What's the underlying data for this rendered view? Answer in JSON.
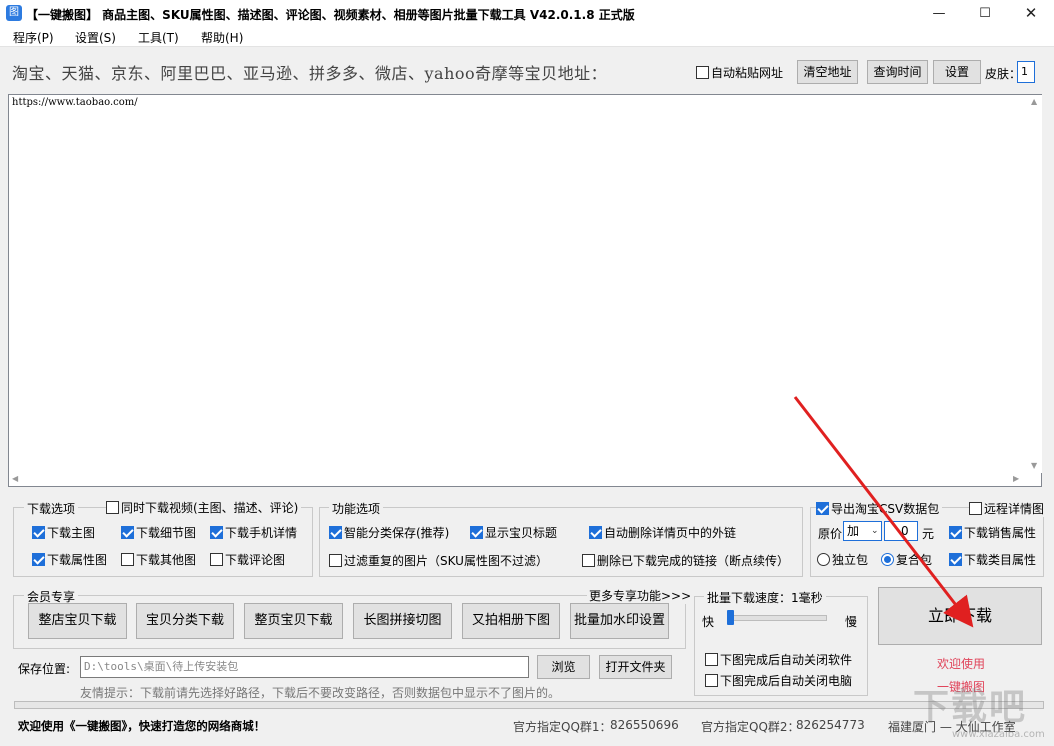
{
  "window": {
    "title": "【一键搬图】 商品主图、SKU属性图、描述图、评论图、视频素材、相册等图片批量下载工具 V42.0.1.8 正式版",
    "min_glyph": "—",
    "max_glyph": "☐",
    "close_glyph": "✕"
  },
  "menu": {
    "items": [
      "程序(P)",
      "设置(S)",
      "工具(T)",
      "帮助(H)"
    ]
  },
  "address": {
    "label": "淘宝、天猫、京东、阿里巴巴、亚马逊、拼多多、微店、yahoo奇摩等宝贝地址：",
    "auto_paste": "自动粘贴网址",
    "auto_paste_checked": false,
    "clear_button": "清空地址",
    "query_time_button": "查询时间",
    "settings_button": "设置",
    "skin_label": "皮肤：",
    "skin_value": "1",
    "url_text": "https://www.taobao.com/"
  },
  "download_options": {
    "title": "下载选项",
    "video_option": {
      "label": "同时下载视频(主图、描述、评论)",
      "checked": false
    },
    "items": [
      {
        "label": "下载主图",
        "checked": true
      },
      {
        "label": "下载细节图",
        "checked": true
      },
      {
        "label": "下载手机详情",
        "checked": true
      },
      {
        "label": "下载属性图",
        "checked": true
      },
      {
        "label": "下载其他图",
        "checked": false
      },
      {
        "label": "下载评论图",
        "checked": false
      }
    ]
  },
  "function_options": {
    "title": "功能选项",
    "items": [
      {
        "label": "智能分类保存(推荐)",
        "checked": true
      },
      {
        "label": "显示宝贝标题",
        "checked": true
      },
      {
        "label": "自动删除详情页中的外链",
        "checked": true
      },
      {
        "label": "过滤重复的图片（SKU属性图不过滤）",
        "checked": false
      },
      {
        "label": "删除已下载完成的链接（断点续传）",
        "checked": false
      }
    ]
  },
  "csv_options": {
    "export_csv": {
      "label": "导出淘宝CSV数据包",
      "checked": true
    },
    "remote_detail": {
      "label": "远程详情图",
      "checked": false
    },
    "price_label": "原价",
    "price_op": "加",
    "price_value": "0",
    "currency": "元",
    "sales_attr": {
      "label": "下载销售属性",
      "checked": true
    },
    "category_attr": {
      "label": "下载类目属性",
      "checked": true
    },
    "pack_independent": {
      "label": "独立包",
      "checked": false
    },
    "pack_composite": {
      "label": "复合包",
      "checked": true
    }
  },
  "member": {
    "title": "会员专享",
    "more_link": "更多专享功能>>>",
    "buttons": [
      "整店宝贝下载",
      "宝贝分类下载",
      "整页宝贝下载",
      "长图拼接切图",
      "又拍相册下图",
      "批量加水印设置"
    ]
  },
  "speed": {
    "title": "批量下载速度：1毫秒",
    "fast": "快",
    "slow": "慢",
    "auto_close_app": {
      "label": "下图完成后自动关闭软件",
      "checked": false
    },
    "auto_shutdown": {
      "label": "下图完成后自动关闭电脑",
      "checked": false
    }
  },
  "download_button": "立即下载",
  "save": {
    "label": "保存位置:",
    "path": "D:\\tools\\桌面\\待上传安装包",
    "browse_button": "浏览",
    "open_folder_button": "打开文件夹",
    "tip": "友情提示：下载前请先选择好路径，下载后不要改变路径，否则数据包中显示不了图片的。"
  },
  "links": {
    "welcome": "欢迎使用",
    "brand": "一键搬图"
  },
  "status": {
    "welcome": "欢迎使用《一键搬图》，快速打造您的网络商城！",
    "qq1_label": "官方指定QQ群1：",
    "qq1_value": "826550696",
    "qq2_label": "官方指定QQ群2：",
    "qq2_value": "826254773",
    "studio": "福建厦门 — 大仙工作室"
  },
  "watermark": {
    "text": "下载吧",
    "url": "www.xiazaiba.com"
  },
  "colors": {
    "accent": "#1e6fd9",
    "link_pink": "#e0445a",
    "arrow_red": "#e02020"
  }
}
